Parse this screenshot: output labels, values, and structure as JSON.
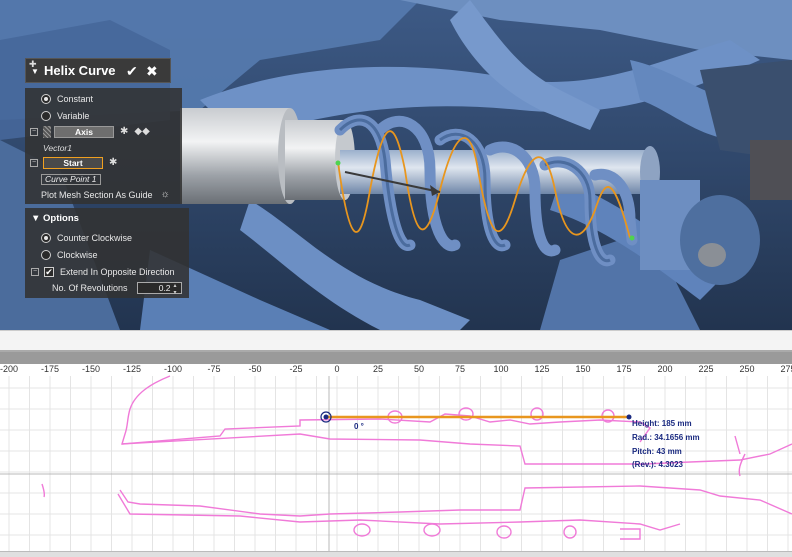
{
  "panel": {
    "title": "Helix Curve",
    "confirm_icon": "checkmark-icon",
    "close_icon": "close-icon",
    "mode_options": [
      "Constant",
      "Variable"
    ],
    "mode_selected": "Constant",
    "axis_label": "Axis",
    "axis_value": "Vector1",
    "start_label": "Start",
    "start_value": "Curve Point 1",
    "plot_mesh_label": "Plot Mesh Section As Guide"
  },
  "options": {
    "title": "Options",
    "direction_options": [
      "Counter Clockwise",
      "Clockwise"
    ],
    "direction_selected": "Counter Clockwise",
    "extend_label": "Extend In Opposite Direction",
    "extend_checked": true,
    "revolutions_label": "No. Of Revolutions",
    "revolutions_value": "0.2"
  },
  "section_view": {
    "ruler_ticks": [
      "-200",
      "-175",
      "-150",
      "-125",
      "-100",
      "-75",
      "-50",
      "-25",
      "0",
      "25",
      "50",
      "75",
      "100",
      "125",
      "150",
      "175",
      "200",
      "225",
      "250",
      "275"
    ],
    "angle": "0 °",
    "height_text": "Height:   185 mm",
    "rad_text": "Rad.:   34.1656 mm",
    "pitch_text": "Pitch:   43 mm",
    "rev_text": "(Rev.):   4.3023"
  },
  "colors": {
    "mesh": "#5b80b8",
    "helix": "#e8961e",
    "section_curve": "#f07ad8",
    "annotation": "#1a2a80"
  }
}
